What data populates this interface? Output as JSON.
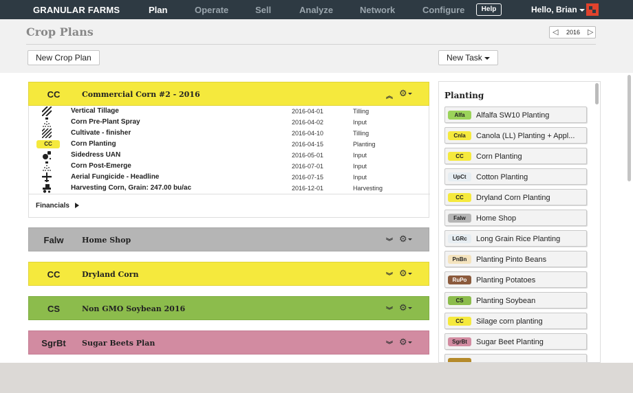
{
  "nav": {
    "brand": "GRANULAR FARMS",
    "links": [
      "Plan",
      "Operate",
      "Sell",
      "Analyze",
      "Network",
      "Configure"
    ],
    "active": "Plan",
    "help": "Help",
    "user": "Hello, Brian"
  },
  "header": {
    "title": "Crop Plans",
    "year": "2016",
    "new_plan": "New Crop Plan",
    "new_task": "New Task"
  },
  "plans": [
    {
      "code": "CC",
      "name": "Commercial Corn #2 - 2016",
      "color": "#f5e93d",
      "expanded": true,
      "tasks": [
        {
          "icon": "tillage-icon",
          "name": "Vertical Tillage",
          "date": "2016-04-01",
          "type": "Tilling"
        },
        {
          "icon": "spray-icon",
          "name": "Corn Pre-Plant Spray",
          "date": "2016-04-02",
          "type": "Input"
        },
        {
          "icon": "tillage-icon",
          "name": "Cultivate - finisher",
          "date": "2016-04-10",
          "type": "Tilling"
        },
        {
          "icon": "badge",
          "badge": "CC",
          "name": "Corn Planting",
          "date": "2016-04-15",
          "type": "Planting"
        },
        {
          "icon": "fertilizer-icon",
          "name": "Sidedress UAN",
          "date": "2016-05-01",
          "type": "Input"
        },
        {
          "icon": "spray-icon",
          "name": "Corn Post-Emerge",
          "date": "2016-07-01",
          "type": "Input"
        },
        {
          "icon": "plane-icon",
          "name": "Aerial Fungicide - Headline",
          "date": "2016-07-15",
          "type": "Input"
        },
        {
          "icon": "harvester-icon",
          "name": "Harvesting Corn, Grain: 247.00 bu/ac",
          "date": "2016-12-01",
          "type": "Harvesting"
        }
      ],
      "financials": "Financials"
    },
    {
      "code": "Falw",
      "name": "Home Shop",
      "color": "#b5b5b5"
    },
    {
      "code": "CC",
      "name": "Dryland Corn",
      "color": "#f5e93d"
    },
    {
      "code": "CS",
      "name": "Non GMO Soybean 2016",
      "color": "#8cbc4c"
    },
    {
      "code": "SgrBt",
      "name": "Sugar Beets Plan",
      "color": "#d28ba1"
    }
  ],
  "panel": {
    "title": "Planting",
    "templates": [
      {
        "badge": "Alfa",
        "color": "#9bd35a",
        "label": "Alfalfa SW10 Planting"
      },
      {
        "badge": "Cnla",
        "color": "#f5e93d",
        "label": "Canola (LL) Planting + Appl..."
      },
      {
        "badge": "CC",
        "color": "#f5e93d",
        "label": "Corn Planting"
      },
      {
        "badge": "UpCt",
        "color": "#e6edf2",
        "label": "Cotton Planting"
      },
      {
        "badge": "CC",
        "color": "#f5e93d",
        "label": "Dryland Corn Planting"
      },
      {
        "badge": "Falw",
        "color": "#b5b5b5",
        "label": "Home Shop"
      },
      {
        "badge": "LGRc",
        "color": "#e6edf2",
        "label": "Long Grain Rice Planting"
      },
      {
        "badge": "PnBn",
        "color": "#f4e3bd",
        "label": "Planting Pinto Beans"
      },
      {
        "badge": "RuPo",
        "color": "#8b5a3c",
        "label": "Planting Potatoes"
      },
      {
        "badge": "CS",
        "color": "#8cbc4c",
        "label": "Planting Soybean"
      },
      {
        "badge": "CC",
        "color": "#f5e93d",
        "label": "Silage corn planting"
      },
      {
        "badge": "SgrBt",
        "color": "#d28ba1",
        "label": "Sugar Beet Planting"
      },
      {
        "badge": "",
        "color": "#b58a2a",
        "label": ""
      }
    ]
  }
}
